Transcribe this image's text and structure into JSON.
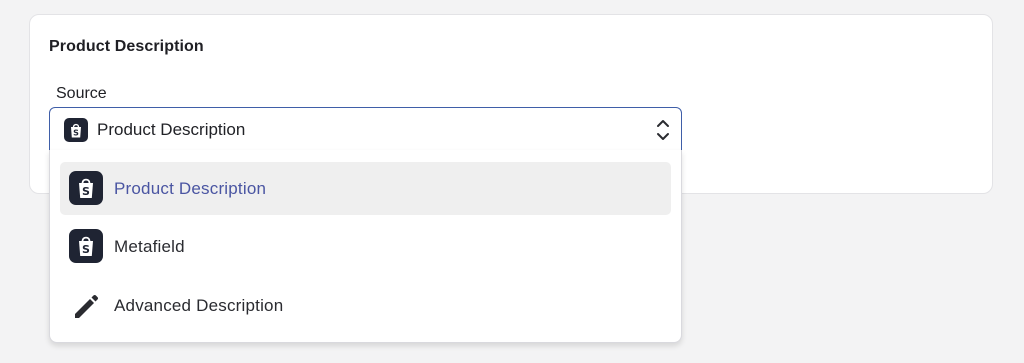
{
  "card": {
    "title": "Product Description"
  },
  "source": {
    "label": "Source",
    "selected_value": "Product Description",
    "selected_icon": "shopify-bag-icon"
  },
  "dropdown": {
    "options": [
      {
        "label": "Product Description",
        "icon": "shopify-bag-icon",
        "selected": true
      },
      {
        "label": "Metafield",
        "icon": "shopify-bag-icon",
        "selected": false
      },
      {
        "label": "Advanced Description",
        "icon": "pencil-icon",
        "selected": false
      }
    ]
  },
  "colors": {
    "accent": "#3f5ea8",
    "selected_text": "#4a55a2",
    "icon_badge": "#1f2433"
  }
}
